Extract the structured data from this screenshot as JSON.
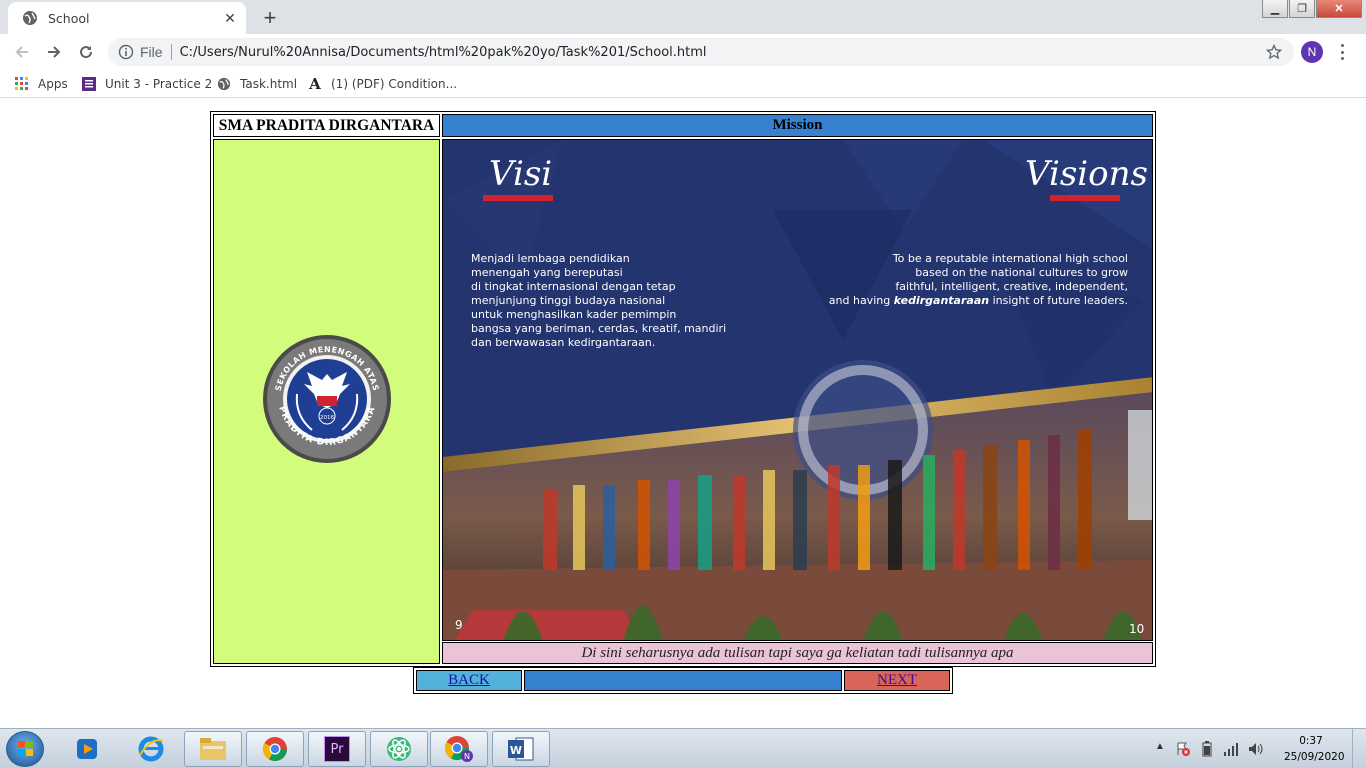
{
  "browser": {
    "tab_title": "School",
    "omnibox_scheme": "File",
    "url": "C:/Users/Nurul%20Annisa/Documents/html%20pak%20yo/Task%201/School.html",
    "profile_initial": "N",
    "bookmarks": [
      {
        "label": "Apps",
        "icon": "apps-grid-icon"
      },
      {
        "label": "Unit 3 - Practice 2",
        "icon": "document-list-icon"
      },
      {
        "label": "Task.html",
        "icon": "globe-icon"
      },
      {
        "label": "(1) (PDF) Condition...",
        "icon": "academia-a-icon"
      }
    ]
  },
  "page": {
    "school_name": "SMA PRADITA DIRGANTARA",
    "section_heading": "Mission",
    "caption": "Di sini seharusnya ada tulisan tapi saya ga keliatan tadi tulisannya apa",
    "back_label": "BACK",
    "next_label": "NEXT",
    "logo": {
      "top_text": "SEKOLAH MENENGAH ATAS",
      "bottom_text": "PRADITA DIRGANTARA",
      "year": "2016"
    },
    "slide": {
      "left_title": "Visi",
      "right_title": "Visions",
      "left_text_lines": [
        "Menjadi lembaga pendidikan",
        "menengah yang bereputasi",
        "di tingkat internasional dengan tetap",
        "menjunjung tinggi budaya nasional",
        "untuk menghasilkan kader pemimpin",
        "bangsa yang beriman, cerdas, kreatif, mandiri",
        "dan berwawasan kedirgantaraan."
      ],
      "right_text_lines": [
        "To be a reputable international high school",
        "based on  the national cultures to grow",
        "faithful, intelligent, creative, independent,"
      ],
      "right_last_line_pre": "and having ",
      "right_last_line_em": "kedirgantaraan",
      "right_last_line_post": " insight of future leaders.",
      "page_left": "9",
      "page_right": "10",
      "accent_color": "#d3222f",
      "background_color": "#23346f"
    }
  },
  "taskbar": {
    "apps": [
      "windows-media-player-icon",
      "internet-explorer-icon",
      "file-explorer-icon",
      "chrome-icon",
      "premiere-pro-icon",
      "atom-icon",
      "chrome-profile-icon",
      "word-icon"
    ],
    "premiere_label": "Pr",
    "time": "0:37",
    "date": "25/09/2020"
  },
  "colors": {
    "school_cell": "#d4fc7c",
    "mission_head": "#3682d1",
    "caption_bg": "#ebc3d6",
    "back_bg": "#53b1da",
    "next_bg": "#d96559"
  }
}
